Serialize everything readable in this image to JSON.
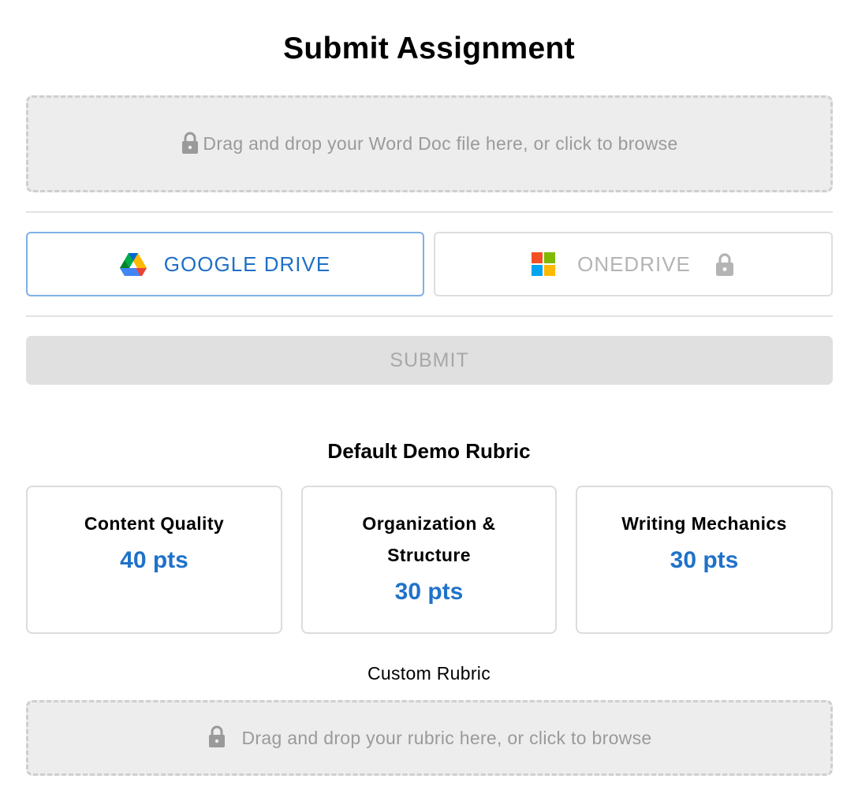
{
  "page": {
    "title": "Submit Assignment"
  },
  "file_upload": {
    "placeholder": "Drag and drop your Word Doc file here, or click to browse",
    "icon": "lock-icon"
  },
  "providers": {
    "google_drive": {
      "label": "GOOGLE DRIVE",
      "icon": "google-drive-icon",
      "color": "#1f6fc5"
    },
    "onedrive": {
      "label": "ONEDRIVE",
      "icon": "microsoft-icon",
      "locked": true,
      "color": "#b4b4b4"
    }
  },
  "submit": {
    "label": "SUBMIT",
    "disabled": true
  },
  "rubric": {
    "heading": "Default Demo Rubric",
    "criteria": [
      {
        "name": "Content Quality",
        "points": "40 pts"
      },
      {
        "name": "Organization & Structure",
        "points": "30 pts"
      },
      {
        "name": "Writing Mechanics",
        "points": "30 pts"
      }
    ]
  },
  "custom_rubric": {
    "label": "Custom Rubric",
    "placeholder": "Drag and drop your rubric here, or click to browse",
    "icon": "lock-icon"
  },
  "colors": {
    "accent": "#1f72c9",
    "dropzone_bg": "#ededed",
    "disabled_text": "#a8a8a8"
  }
}
